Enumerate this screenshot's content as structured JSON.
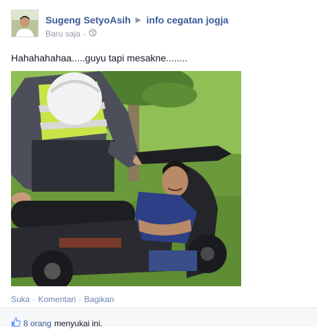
{
  "post": {
    "author": "Sugeng SetyoAsih",
    "group": "info cegatan jogja",
    "timestamp": "Baru saja",
    "separator": "·",
    "privacy_icon": "globe-icon",
    "text": "Hahahahahaa.....guyu tapi mesakne........",
    "photo_description_icon": "photo"
  },
  "actions": {
    "like": "Suka",
    "comment": "Komentari",
    "share": "Bagikan",
    "separator": "·"
  },
  "likes": {
    "count": "8 orang",
    "suffix": "menyukai ini."
  },
  "colors": {
    "link": "#3b5998",
    "meta": "#9197a3",
    "action_link": "#6d84b4"
  }
}
